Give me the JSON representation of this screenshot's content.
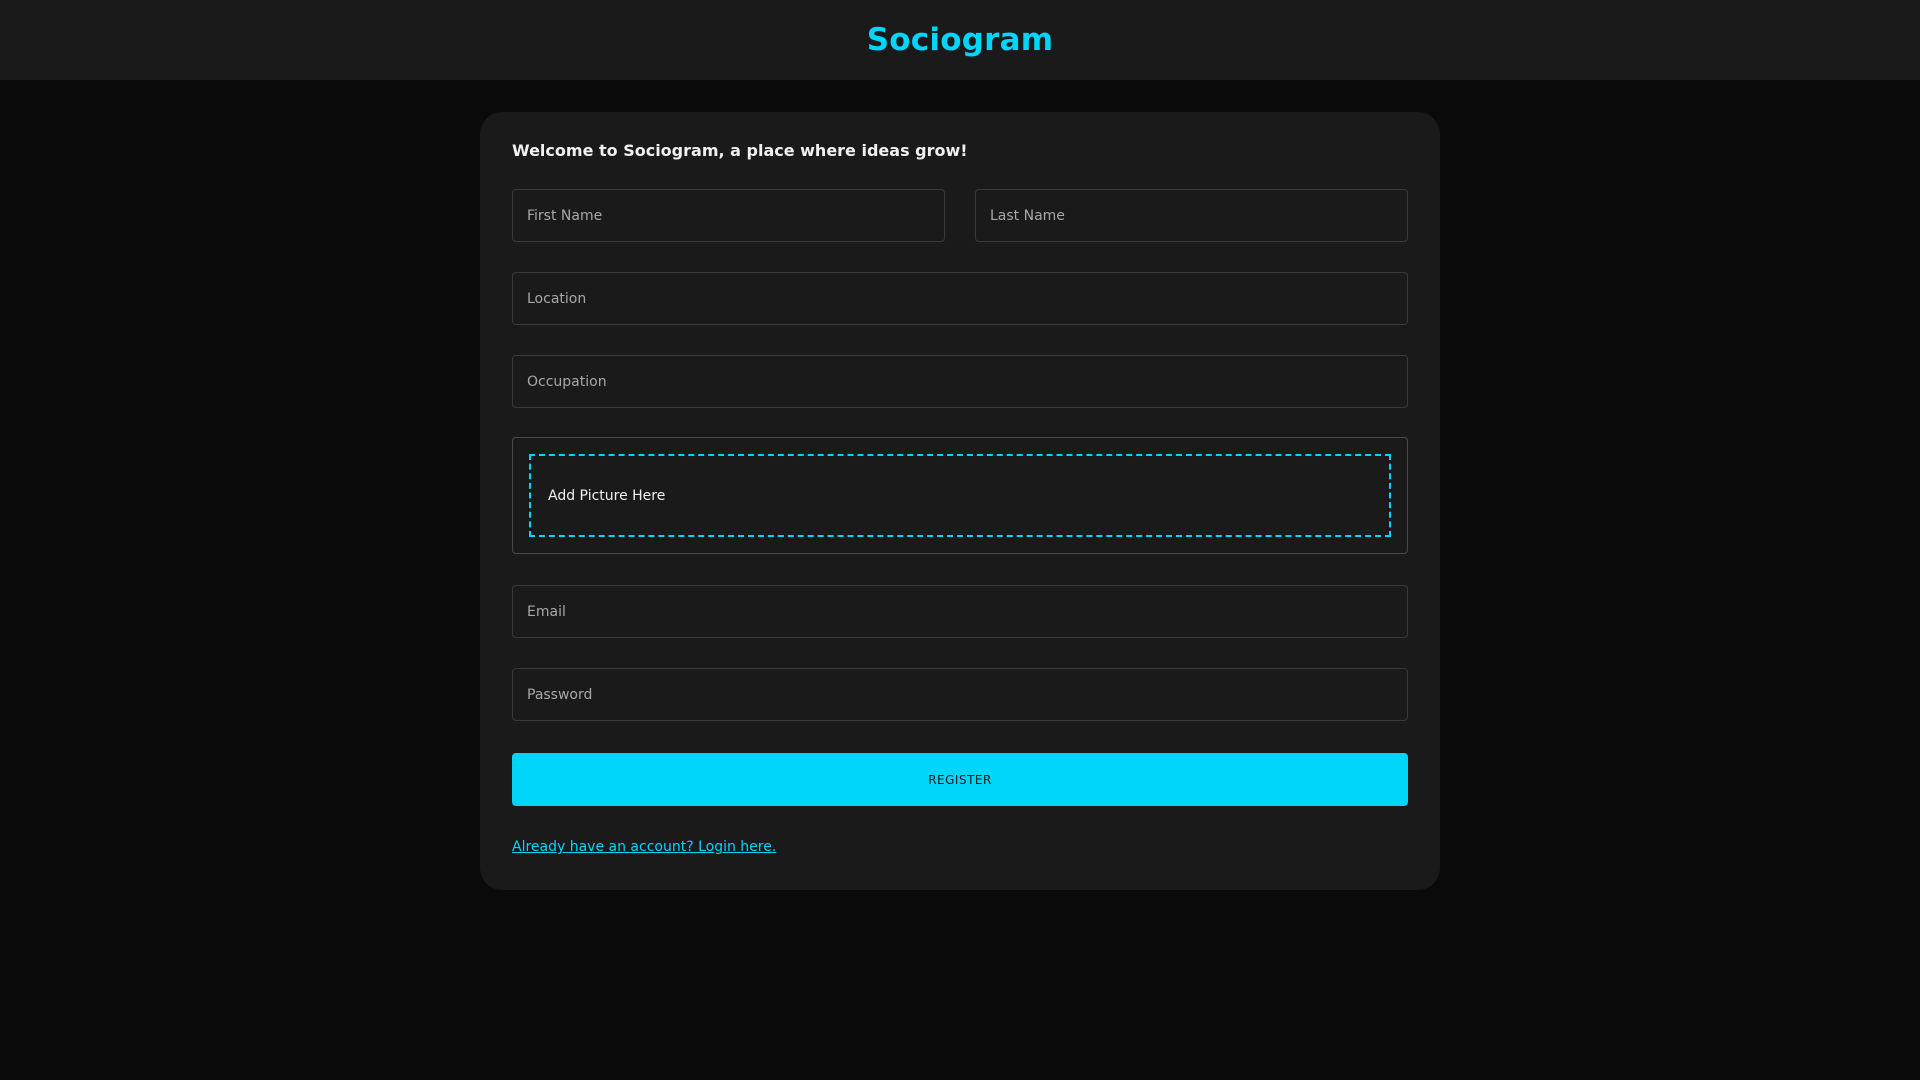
{
  "header": {
    "brand": "Sociogram"
  },
  "form": {
    "welcome": "Welcome to Sociogram, a place where ideas grow!",
    "first_name_placeholder": "First Name",
    "last_name_placeholder": "Last Name",
    "location_placeholder": "Location",
    "occupation_placeholder": "Occupation",
    "picture_label": "Add Picture Here",
    "email_placeholder": "Email",
    "password_placeholder": "Password",
    "register_label": "REGISTER",
    "login_link": "Already have an account? Login here."
  },
  "colors": {
    "accent": "#00d5fa",
    "background": "#0a0a0a",
    "surface": "#1a1a1a"
  }
}
